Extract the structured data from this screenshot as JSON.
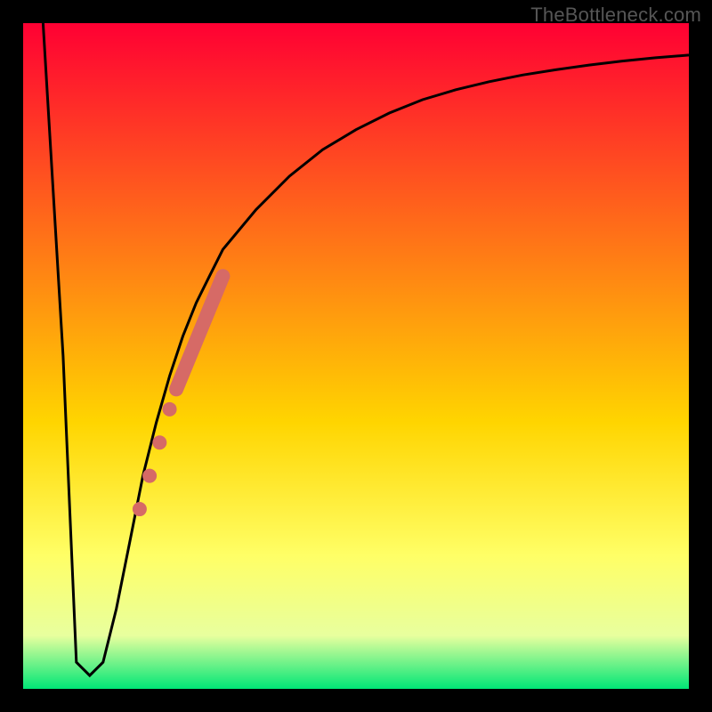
{
  "watermark": "TheBottleneck.com",
  "chart_data": {
    "type": "line",
    "title": "",
    "xlabel": "",
    "ylabel": "",
    "xlim": [
      0,
      100
    ],
    "ylim": [
      0,
      100
    ],
    "grid": false,
    "series": [
      {
        "name": "bottleneck-curve",
        "x": [
          3,
          6,
          8,
          10,
          12,
          14,
          16,
          18,
          20,
          22,
          24,
          26,
          28,
          30,
          35,
          40,
          45,
          50,
          55,
          60,
          65,
          70,
          75,
          80,
          85,
          90,
          95,
          100
        ],
        "values": [
          100,
          50,
          4,
          2,
          4,
          12,
          22,
          32,
          40,
          47,
          53,
          58,
          62,
          66,
          72,
          77,
          81,
          84,
          86.5,
          88.5,
          90,
          91.2,
          92.2,
          93,
          93.7,
          94.3,
          94.8,
          95.2
        ]
      }
    ],
    "markers": [
      {
        "name": "marker-1",
        "x": 17.5,
        "y": 27
      },
      {
        "name": "marker-2",
        "x": 19.0,
        "y": 32
      },
      {
        "name": "marker-3",
        "x": 20.5,
        "y": 37
      },
      {
        "name": "marker-4",
        "x": 22.0,
        "y": 42
      }
    ],
    "segments": [
      {
        "name": "thick-segment",
        "x0": 23,
        "y0": 45,
        "x1": 30,
        "y1": 62
      }
    ],
    "colors": {
      "border": "#000000",
      "curve": "#000000",
      "marker": "#d66a66",
      "gradient_stops": [
        {
          "offset": 0,
          "color": "#ff0033"
        },
        {
          "offset": 60,
          "color": "#ffd500"
        },
        {
          "offset": 80,
          "color": "#ffff66"
        },
        {
          "offset": 92,
          "color": "#e8ff9e"
        },
        {
          "offset": 100,
          "color": "#00e676"
        }
      ]
    },
    "border_width": 26
  }
}
